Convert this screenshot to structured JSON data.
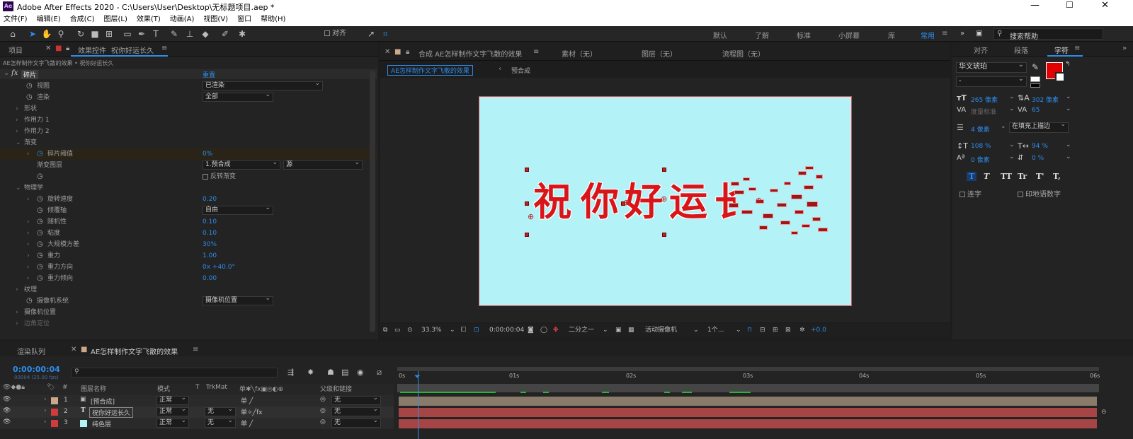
{
  "app": {
    "title": "Adobe After Effects 2020 - C:\\Users\\User\\Desktop\\无标题项目.aep *",
    "logo": "Ae"
  },
  "menu": [
    "文件(F)",
    "编辑(E)",
    "合成(C)",
    "图层(L)",
    "效果(T)",
    "动画(A)",
    "视图(V)",
    "窗口",
    "帮助(H)"
  ],
  "toolbar": {
    "align_label": "对齐",
    "workspaces": [
      "默认",
      "了解",
      "标准",
      "小屏幕",
      "库",
      "常用"
    ],
    "active_workspace": "常用",
    "search_placeholder": "搜索帮助"
  },
  "effects_panel": {
    "tabs": {
      "project": "项目",
      "effect_controls": "效果控件",
      "layer": "祝你好运长久"
    },
    "breadcrumb": "AE怎样制作文字飞散的效果 • 祝你好运长久",
    "effect_name": "碎片",
    "reset": "重置",
    "rows": [
      {
        "label": "视图",
        "value": "已渲染",
        "kind": "dropdown"
      },
      {
        "label": "渲染",
        "value": "全部",
        "kind": "dropdown"
      },
      {
        "label": "形状",
        "kind": "group"
      },
      {
        "label": "作用力 1",
        "kind": "group"
      },
      {
        "label": "作用力 2",
        "kind": "group"
      },
      {
        "label": "渐变",
        "kind": "group-open"
      },
      {
        "label": "碎片阈值",
        "value": "0%",
        "kind": "value"
      },
      {
        "label": "渐变图层",
        "value": "1.预合成",
        "value2": "源",
        "kind": "dropdown2"
      },
      {
        "label": "",
        "value": "反转渐变",
        "kind": "checkbox"
      },
      {
        "label": "物理学",
        "kind": "group-open"
      },
      {
        "label": "旋转速度",
        "value": "0.20",
        "kind": "value"
      },
      {
        "label": "倾覆轴",
        "value": "自由",
        "kind": "dropdown"
      },
      {
        "label": "随机性",
        "value": "0.10",
        "kind": "value"
      },
      {
        "label": "粘度",
        "value": "0.10",
        "kind": "value"
      },
      {
        "label": "大规模方差",
        "value": "30%",
        "kind": "value"
      },
      {
        "label": "重力",
        "value": "1.00",
        "kind": "value"
      },
      {
        "label": "重力方向",
        "value": "0x +40.0°",
        "kind": "value"
      },
      {
        "label": "重力倾向",
        "value": "0.00",
        "kind": "value"
      },
      {
        "label": "纹理",
        "kind": "group"
      },
      {
        "label": "摄像机系统",
        "value": "摄像机位置",
        "kind": "dropdown"
      },
      {
        "label": "摄像机位置",
        "kind": "group"
      },
      {
        "label": "边角定位",
        "kind": "group"
      }
    ]
  },
  "comp_panel": {
    "tab": "合成 AE怎样制作文字飞散的效果",
    "footage": "素材（无）",
    "layer": "图层（无）",
    "flowchart": "流程图（无）",
    "breadcrumb_active": "AE怎样制作文字飞散的效果",
    "breadcrumb_next": "预合成",
    "canvas_text": [
      "祝",
      "你",
      "好",
      "运",
      "长"
    ],
    "canvas_bg": "#b3f2f7",
    "text_color": "#d8161a",
    "footer": {
      "zoom": "33.3%",
      "timecode": "0:00:00:04",
      "resolution": "二分之一",
      "camera": "活动摄像机",
      "views": "1个...",
      "exposure": "+0.0"
    }
  },
  "character_panel": {
    "tabs": [
      "对齐",
      "段落",
      "字符"
    ],
    "font": "华文琥珀",
    "style": "-",
    "size": "265 像素",
    "leading": "302 像素",
    "kerning": "度量标准",
    "tracking": "65",
    "stroke": "4 像素",
    "stroke_mode": "在填充上描边",
    "v_scale": "108 %",
    "h_scale": "94 %",
    "baseline": "0 像素",
    "tsume": "0 %",
    "styles": [
      "T",
      "T",
      "TT",
      "Tr",
      "T'",
      "T,"
    ],
    "ligature": "连字",
    "hindi": "印地语数字",
    "fill_color": "#e00000"
  },
  "timeline": {
    "render_queue": "渲染队列",
    "comp_tab": "AE怎样制作文字飞散的效果",
    "timecode": "0:00:00:04",
    "frame_info": "00004 (25.00 fps)",
    "columns": {
      "layer_name": "图层名称",
      "mode": "模式",
      "t": "T",
      "trkmat": "TrkMat",
      "parent": "父级和链接"
    },
    "ruler": [
      "0s",
      "01s",
      "02s",
      "03s",
      "04s",
      "05s",
      "06s"
    ],
    "layers": [
      {
        "num": "1",
        "name": "[预合成]",
        "mode": "正常",
        "trkmat": "",
        "parent": "无",
        "color": "#c9a98a",
        "bar": "#8a7a6a"
      },
      {
        "num": "2",
        "name": "祝你好运长久",
        "mode": "正常",
        "trkmat": "无",
        "parent": "无",
        "color": "#d03c3c",
        "bar": "#a54545"
      },
      {
        "num": "3",
        "name": "纯色层",
        "mode": "正常",
        "trkmat": "无",
        "parent": "无",
        "color": "#d03c3c",
        "bar": "#a54545"
      }
    ]
  }
}
